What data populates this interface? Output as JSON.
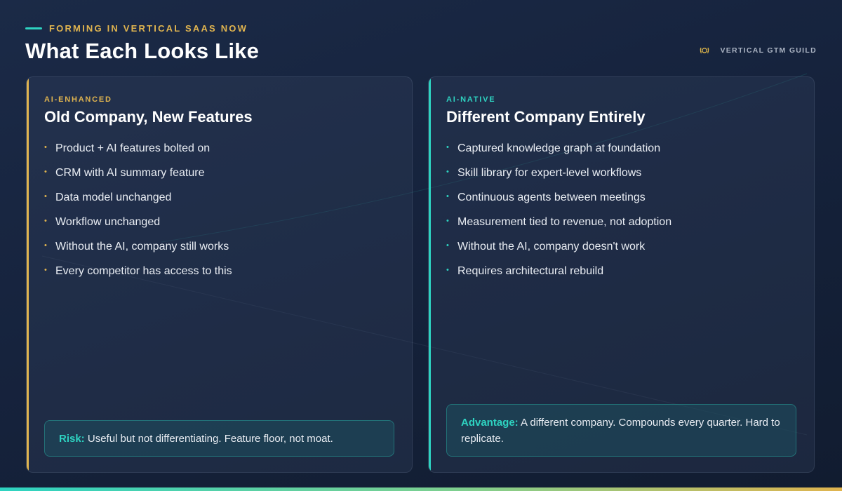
{
  "header": {
    "eyebrow": "FORMING IN VERTICAL SAAS NOW",
    "title": "What Each Looks Like",
    "brand": "VERTICAL GTM GUILD"
  },
  "cards": [
    {
      "tag": "AI-ENHANCED",
      "heading": "Old Company, New Features",
      "bullets": [
        "Product + AI features bolted on",
        "CRM with AI summary feature",
        "Data model unchanged",
        "Workflow unchanged",
        "Without the AI, company still works",
        "Every competitor has access to this"
      ],
      "callout_label": "Risk:",
      "callout_text": "Useful but not differentiating. Feature floor, not moat."
    },
    {
      "tag": "AI-NATIVE",
      "heading": "Different Company Entirely",
      "bullets": [
        "Captured knowledge graph at foundation",
        "Skill library for expert-level workflows",
        "Continuous agents between meetings",
        "Measurement tied to revenue, not adoption",
        "Without the AI, company doesn't work",
        "Requires architectural rebuild"
      ],
      "callout_label": "Advantage:",
      "callout_text": "A different company. Compounds every quarter. Hard to replicate."
    }
  ],
  "colors": {
    "gold_accent": "#e0b44f",
    "teal_accent": "#2ed3c1",
    "background": "#16233d"
  },
  "icons": {
    "brand_logo": "laurel-wreath-icon",
    "bullet": "bullet-dot-icon"
  }
}
